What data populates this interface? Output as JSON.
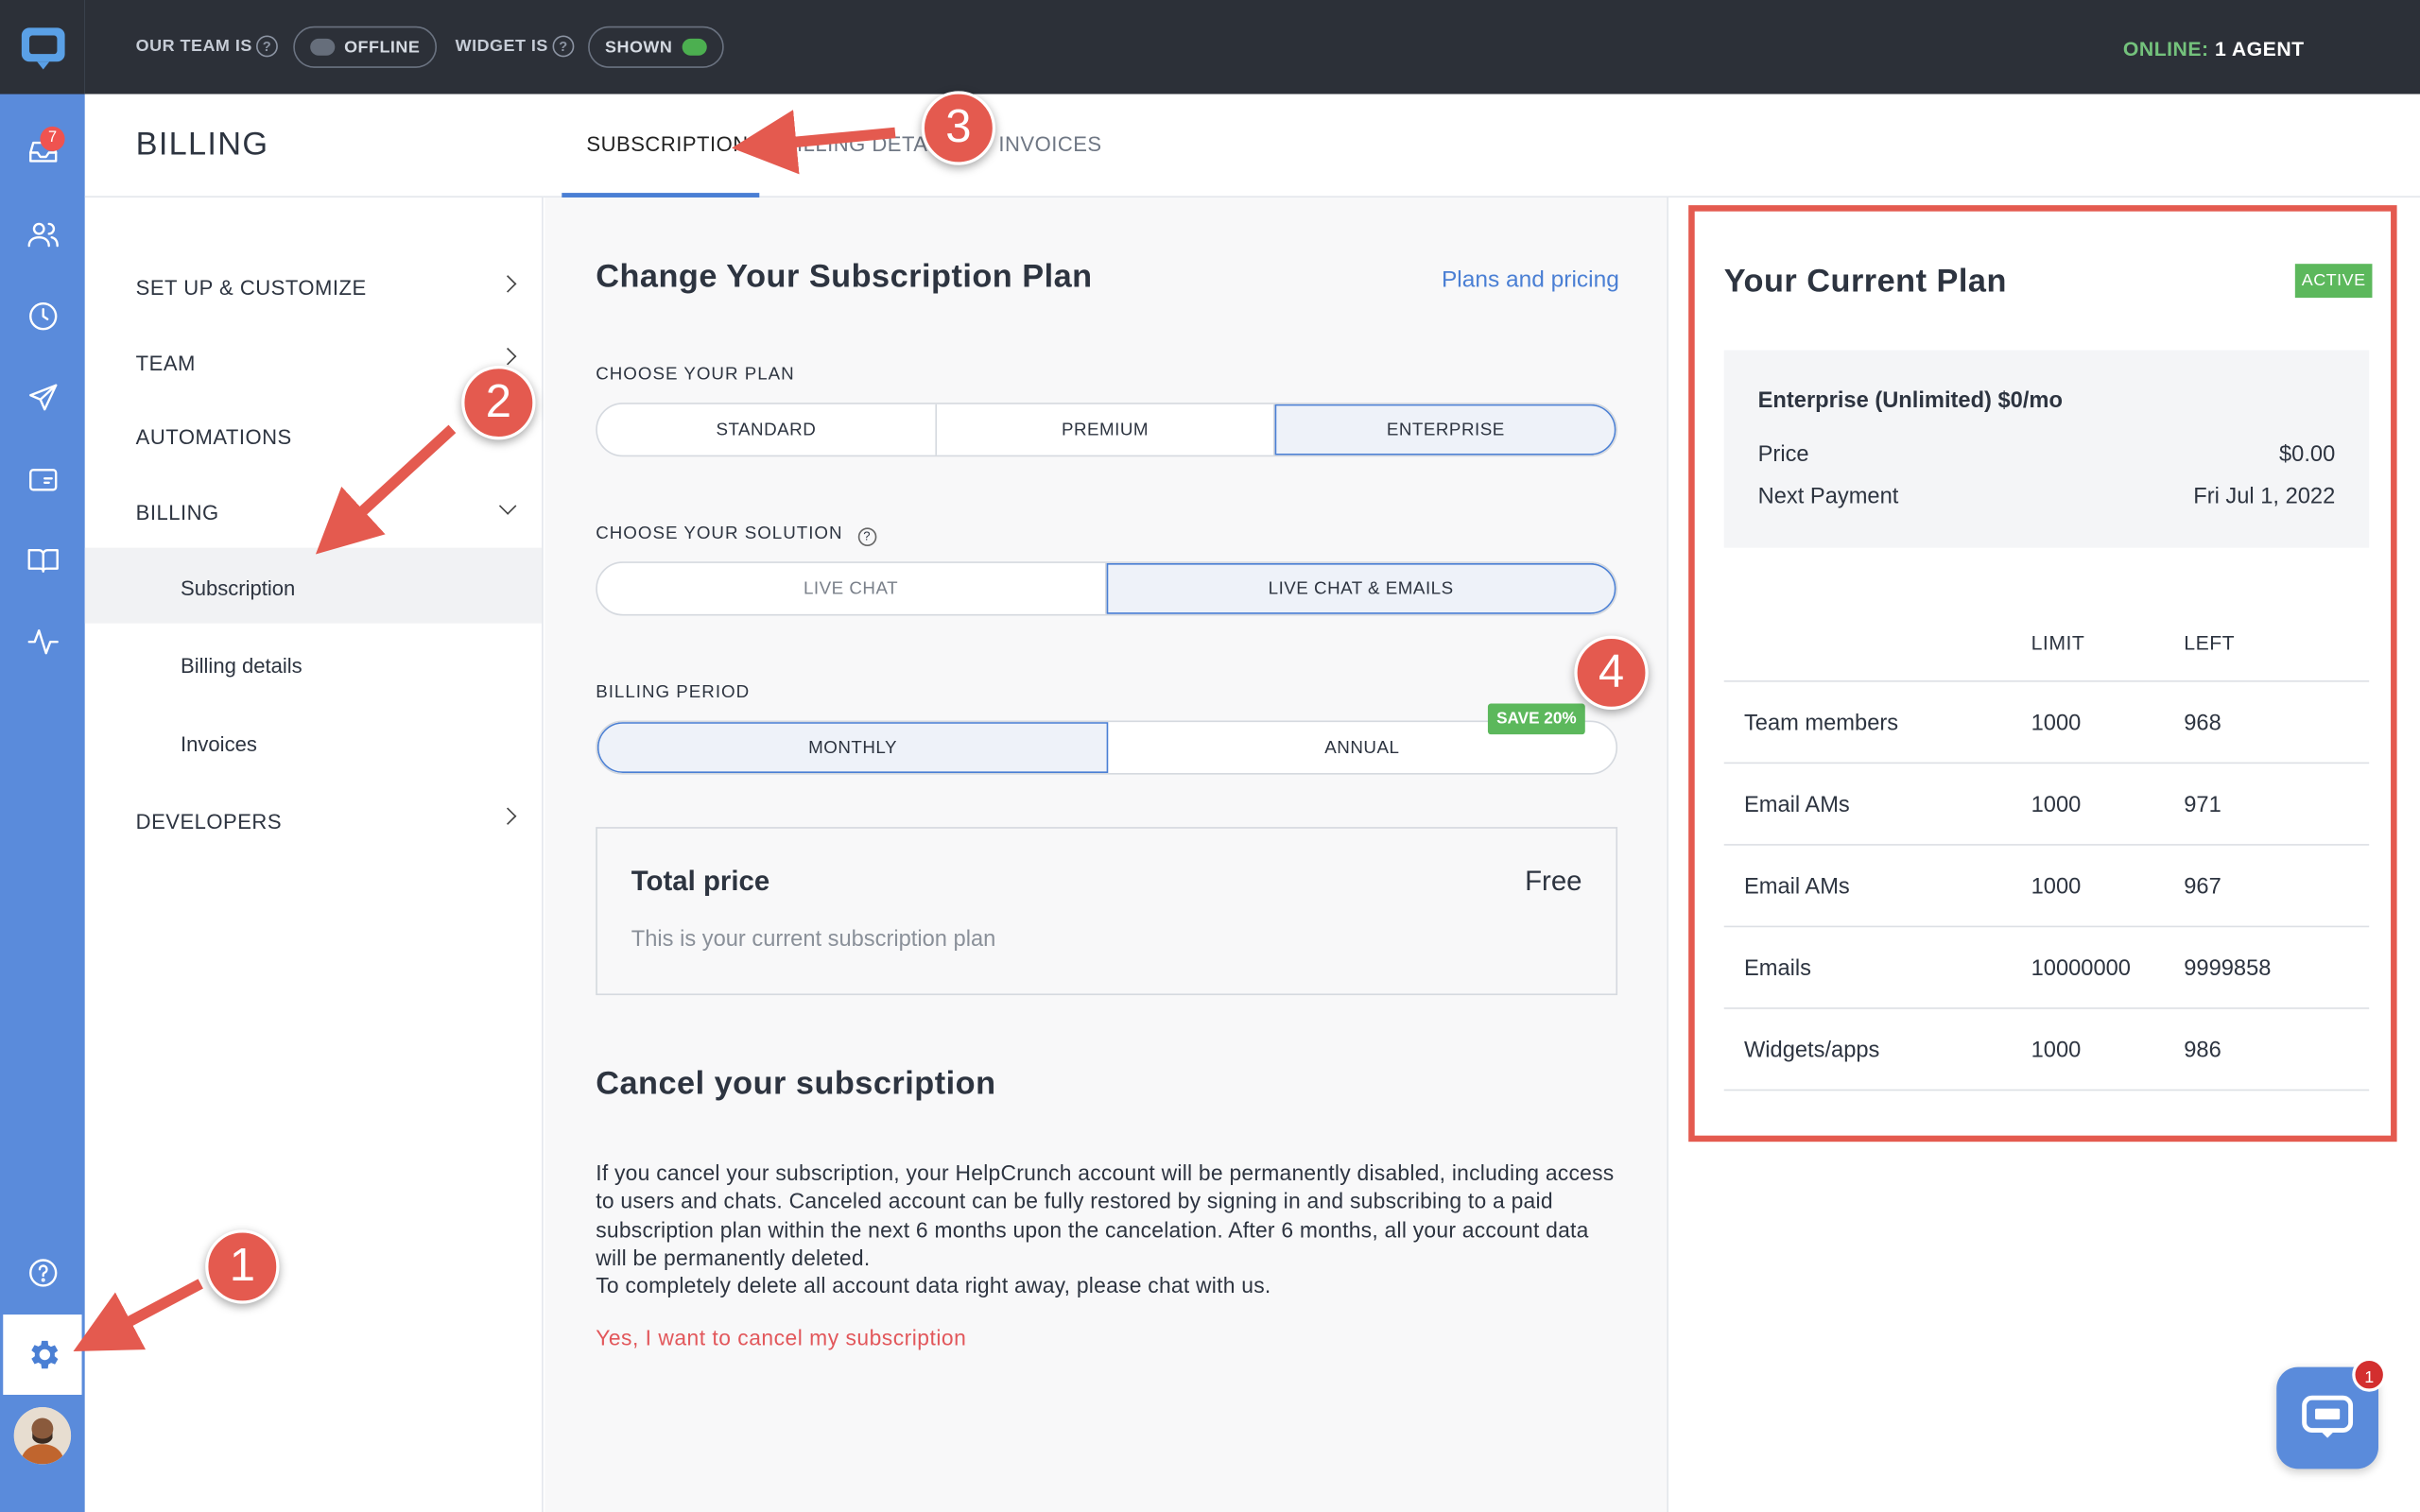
{
  "topbar": {
    "team_label": "OUR TEAM IS",
    "team_status": "OFFLINE",
    "widget_label": "WIDGET IS",
    "widget_status": "SHOWN",
    "online_prefix": "ONLINE:",
    "online_value": "1 AGENT"
  },
  "rail": {
    "inbox_badge": "7",
    "items": [
      "inbox-icon",
      "contacts-icon",
      "history-icon",
      "send-icon",
      "widget-icon",
      "book-icon",
      "activity-icon",
      "help-icon",
      "gear-icon"
    ]
  },
  "header": {
    "title": "BILLING",
    "tabs": [
      {
        "label": "SUBSCRIPTION",
        "active": true
      },
      {
        "label": "BILLING DETAILS",
        "active": false
      },
      {
        "label": "INVOICES",
        "active": false
      }
    ]
  },
  "nav": {
    "items": [
      "SET UP & CUSTOMIZE",
      "TEAM",
      "AUTOMATIONS",
      "BILLING",
      "DEVELOPERS"
    ],
    "billing_sub": [
      "Subscription",
      "Billing details",
      "Invoices"
    ]
  },
  "main": {
    "title": "Change Your Subscription Plan",
    "plans_link": "Plans and pricing",
    "choose_plan_label": "CHOOSE YOUR PLAN",
    "plans": [
      "STANDARD",
      "PREMIUM",
      "ENTERPRISE"
    ],
    "selected_plan": "ENTERPRISE",
    "choose_solution_label": "CHOOSE YOUR SOLUTION",
    "solutions": [
      "LIVE CHAT",
      "LIVE CHAT & EMAILS"
    ],
    "selected_solution": "LIVE CHAT & EMAILS",
    "billing_period_label": "BILLING PERIOD",
    "periods": [
      "MONTHLY",
      "ANNUAL"
    ],
    "selected_period": "MONTHLY",
    "save_badge": "SAVE 20%",
    "total_price_label": "Total price",
    "total_price_value": "Free",
    "total_price_sub": "This is your current subscription plan",
    "cancel_title": "Cancel your subscription",
    "cancel_text_1": "If you cancel your subscription, your HelpCrunch account will be permanently disabled, including access to users and chats. Canceled account can be fully restored by signing in and subscribing to a paid subscription plan within the next 6 months upon the cancelation. After 6 months, all your account data will be permanently deleted.",
    "cancel_text_2": "To completely delete all account data right away, please chat with us.",
    "cancel_link": "Yes, I want to cancel my subscription"
  },
  "plan": {
    "title": "Your Current Plan",
    "status": "ACTIVE",
    "name": "Enterprise (Unlimited) $0/mo",
    "price_label": "Price",
    "price_value": "$0.00",
    "next_payment_label": "Next Payment",
    "next_payment_value": "Fri Jul 1, 2022",
    "limits_header": {
      "limit": "LIMIT",
      "left": "LEFT"
    },
    "limits": [
      {
        "name": "Team members",
        "limit": "1000",
        "left": "968"
      },
      {
        "name": "Email AMs",
        "limit": "1000",
        "left": "971"
      },
      {
        "name": "Email AMs",
        "limit": "1000",
        "left": "967"
      },
      {
        "name": "Emails",
        "limit": "10000000",
        "left": "9999858"
      },
      {
        "name": "Widgets/apps",
        "limit": "1000",
        "left": "986"
      }
    ]
  },
  "chat_widget": {
    "badge": "1"
  },
  "annotations": [
    "1",
    "2",
    "3",
    "4"
  ],
  "colors": {
    "accent": "#4a7fd4",
    "rail": "#5a8bdb",
    "topbar": "#2c3038",
    "annotation": "#e45a4f",
    "success": "#5cb85c"
  }
}
